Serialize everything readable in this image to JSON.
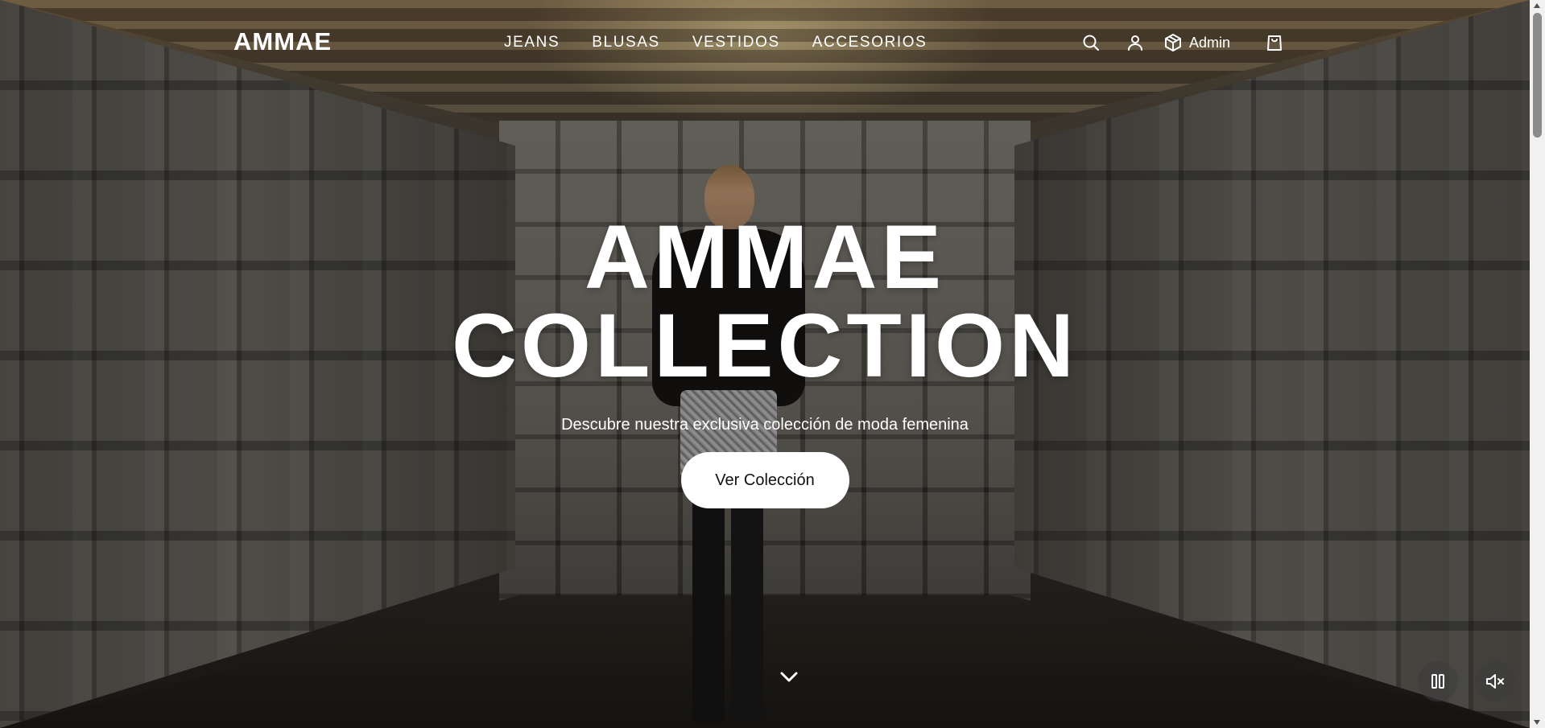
{
  "header": {
    "logo": "AMMAE",
    "nav": [
      {
        "label": "JEANS"
      },
      {
        "label": "BLUSAS"
      },
      {
        "label": "VESTIDOS"
      },
      {
        "label": "ACCESORIOS"
      }
    ],
    "actions": {
      "search_icon": "search-icon",
      "account_icon": "user-icon",
      "admin_icon": "box-icon",
      "admin_label": "Admin",
      "cart_icon": "shopping-bag-icon"
    }
  },
  "hero": {
    "title_line1": "AMMAE",
    "title_line2": "COLLECTION",
    "subtitle": "Descubre nuestra exclusiva colección de moda femenina",
    "cta_label": "Ver Colección",
    "scroll_icon": "chevron-down-icon"
  },
  "video_controls": {
    "pause_icon": "pause-icon",
    "mute_icon": "volume-muted-icon"
  },
  "colors": {
    "text": "#ffffff",
    "cta_bg": "#ffffff",
    "cta_text": "#111111",
    "control_bg": "#3c3c3c"
  }
}
